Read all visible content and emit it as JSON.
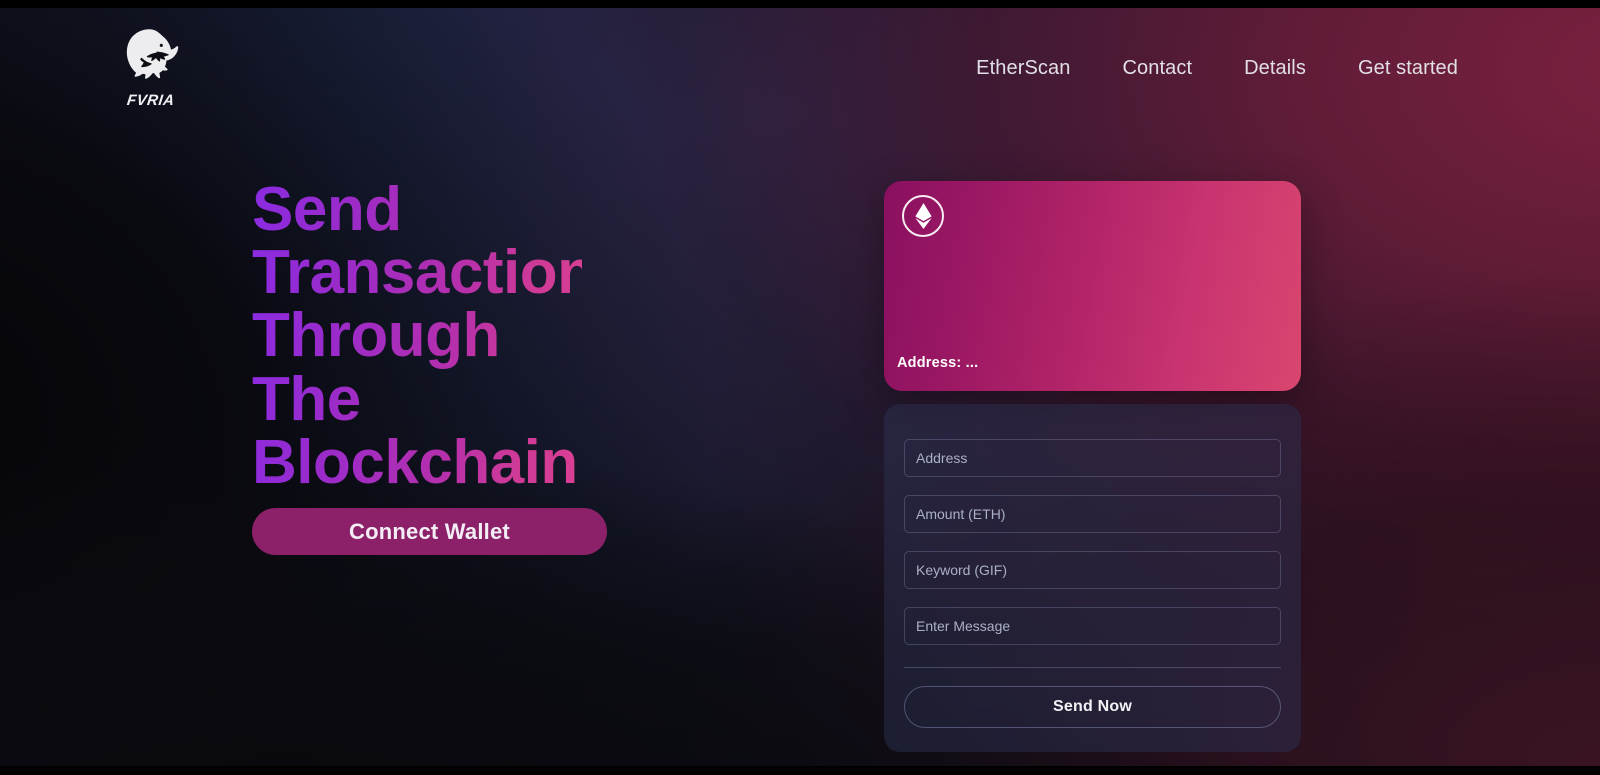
{
  "brand": {
    "logo_icon": "panther-head-icon",
    "name": "FVRIA"
  },
  "nav": {
    "items": [
      {
        "label": "EtherScan"
      },
      {
        "label": "Contact"
      },
      {
        "label": "Details"
      },
      {
        "label": "Get started"
      }
    ]
  },
  "hero": {
    "title": "Send Transaction Through The Blockchain",
    "connect_button": "Connect Wallet"
  },
  "eth_card": {
    "icon": "ethereum-icon",
    "address_label": "Address: ..."
  },
  "form": {
    "fields": [
      {
        "name": "address",
        "placeholder": "Address",
        "value": ""
      },
      {
        "name": "amount",
        "placeholder": "Amount (ETH)",
        "value": ""
      },
      {
        "name": "keyword",
        "placeholder": "Keyword (GIF)",
        "value": ""
      },
      {
        "name": "message",
        "placeholder": "Enter Message",
        "value": ""
      }
    ],
    "submit_label": "Send Now"
  },
  "colors": {
    "accent_purple": "#8a2be2",
    "accent_pink": "#db4094",
    "button_magenta": "#8c2169",
    "card_gradient_start": "#8a1060",
    "card_gradient_end": "#d9466f",
    "background_navy": "#283464",
    "background_maroon": "#7c2140",
    "background_black": "#0b0b10"
  }
}
